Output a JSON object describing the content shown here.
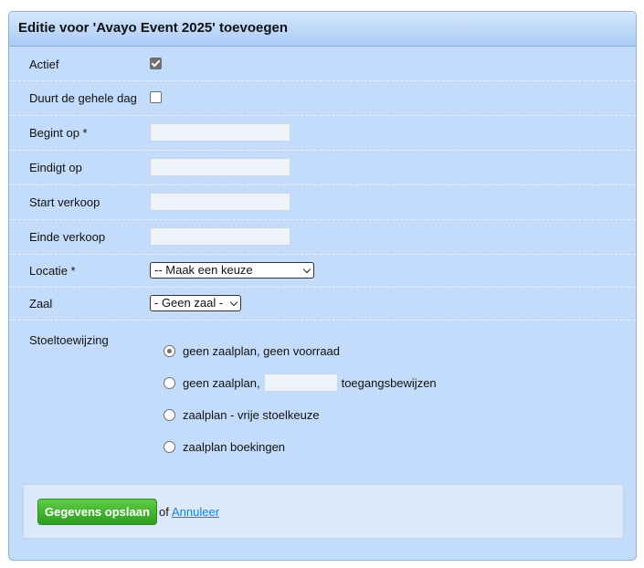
{
  "title": "Editie voor 'Avayo Event 2025' toevoegen",
  "fields": {
    "actief": {
      "label": "Actief",
      "checked": true
    },
    "hele_dag": {
      "label": "Duurt de gehele dag",
      "checked": false
    },
    "begint_op": {
      "label": "Begint op *",
      "value": ""
    },
    "eindigt_op": {
      "label": "Eindigt op",
      "value": ""
    },
    "start_verkoop": {
      "label": "Start verkoop",
      "value": ""
    },
    "einde_verkoop": {
      "label": "Einde verkoop",
      "value": ""
    },
    "locatie": {
      "label": "Locatie *",
      "selected": "-- Maak een keuze"
    },
    "zaal": {
      "label": "Zaal",
      "selected": "- Geen zaal -"
    }
  },
  "stoeltoewijzing": {
    "label": "Stoeltoewijzing",
    "options": [
      {
        "label": "geen zaalplan, geen voorraad",
        "checked": true
      },
      {
        "label": "geen zaalplan,",
        "suffix": "toegangsbewijzen",
        "value": "",
        "checked": false
      },
      {
        "label": "zaalplan - vrije stoelkeuze",
        "checked": false
      },
      {
        "label": "zaalplan boekingen",
        "checked": false
      }
    ]
  },
  "footer": {
    "save_label": "Gegevens opslaan",
    "separator": "of",
    "cancel_label": "Annuleer"
  }
}
